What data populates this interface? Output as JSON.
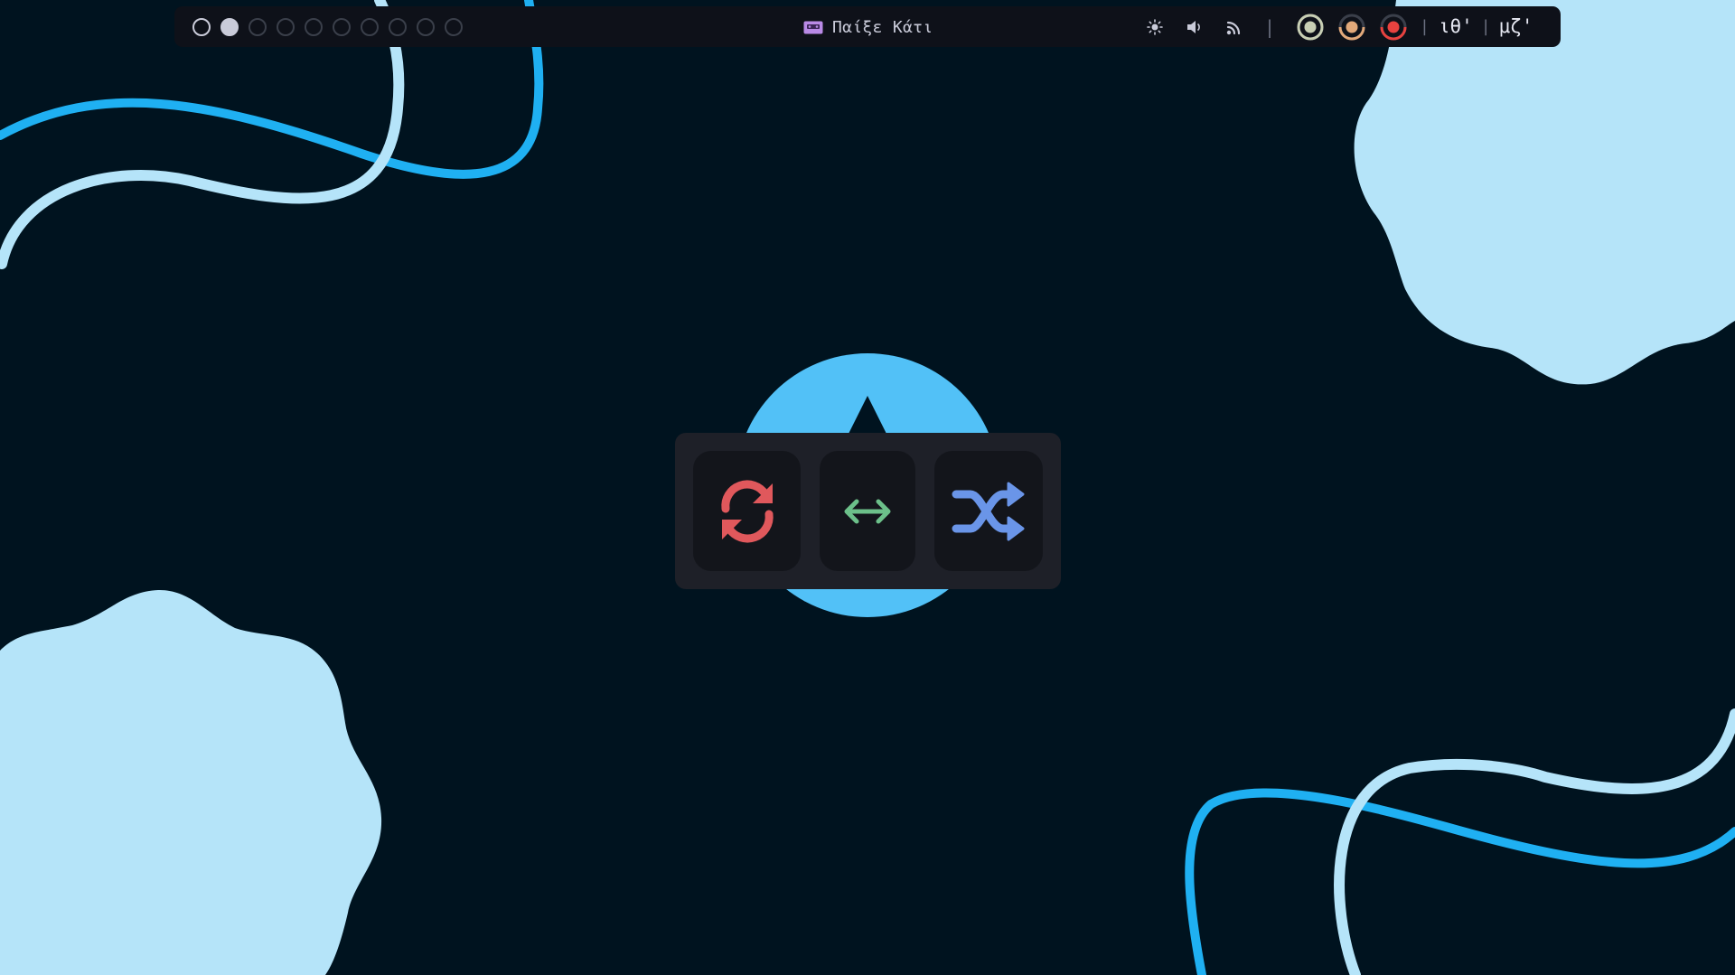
{
  "colors": {
    "background": "#00131f",
    "bar": "#0e1119",
    "cloud": "#b5e4f9",
    "wave_light": "#b5e4f9",
    "wave_dark": "#1fb0f2",
    "logo": "#52c1f7",
    "panel": "#1e2028",
    "button": "#13151b",
    "repeat": "#e0585c",
    "swap": "#6cc08a",
    "shuffle": "#6a95e8",
    "ring_1": "#c8cfb4",
    "ring_2": "#e2a97a",
    "ring_3": "#e8423f"
  },
  "topbar": {
    "workspaces": [
      {
        "state": "occupied"
      },
      {
        "state": "active"
      },
      {
        "state": "empty"
      },
      {
        "state": "empty"
      },
      {
        "state": "empty"
      },
      {
        "state": "empty"
      },
      {
        "state": "empty"
      },
      {
        "state": "empty"
      },
      {
        "state": "empty"
      },
      {
        "state": "empty"
      }
    ],
    "now_playing": {
      "icon": "cassette-tape-icon",
      "label": "Παίξε Κάτι"
    },
    "quick_icons": [
      "brightness-icon",
      "volume-icon",
      "wifi-icon"
    ],
    "separator": "|",
    "status_rings": [
      {
        "name": "cpu-ring",
        "level": 0.45
      },
      {
        "name": "memory-ring",
        "level": 0.5
      },
      {
        "name": "battery-ring",
        "level": 0.5
      }
    ],
    "clock": {
      "hours": "ιθ'",
      "divider": "|",
      "minutes": "μζ'"
    }
  },
  "panel": {
    "buttons": [
      {
        "name": "repeat-button",
        "icon": "repeat-icon"
      },
      {
        "name": "swap-button",
        "icon": "swap-horizontal-icon"
      },
      {
        "name": "shuffle-button",
        "icon": "shuffle-icon"
      }
    ]
  }
}
